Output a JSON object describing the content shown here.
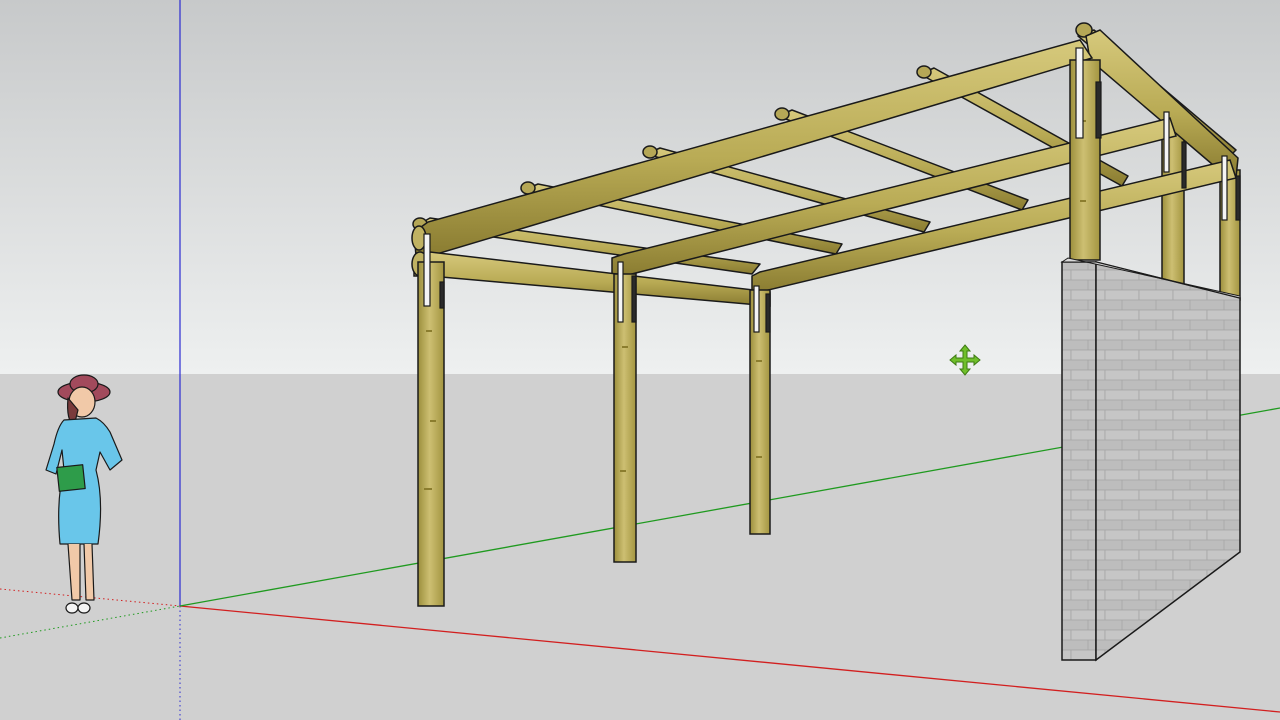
{
  "app": {
    "viewport": "3d-model-viewport"
  },
  "scene": {
    "sky_top": "#c9cbcc",
    "sky_bottom": "#eceeef",
    "ground": "#cfcfcf",
    "wood_light": "#c9bc72",
    "wood_mid": "#a89a45",
    "wood_dark": "#7b6d27",
    "strap_color": "#f4f4f4",
    "block_wall": "#bdbdbd",
    "block_wall_dark": "#a9a9a9",
    "axis_red": "#d21f1f",
    "axis_green": "#1f9a1f",
    "axis_blue": "#2b2bd2",
    "figure_dress": "#69c6ea",
    "figure_hat": "#a24a5c",
    "figure_book": "#2e9c4a",
    "cursor_color": "#6fbf2a",
    "cursor_icon": "move-cursor-icon",
    "objects": [
      "pergola",
      "concrete-block-wall",
      "scale-figure",
      "axes"
    ]
  }
}
